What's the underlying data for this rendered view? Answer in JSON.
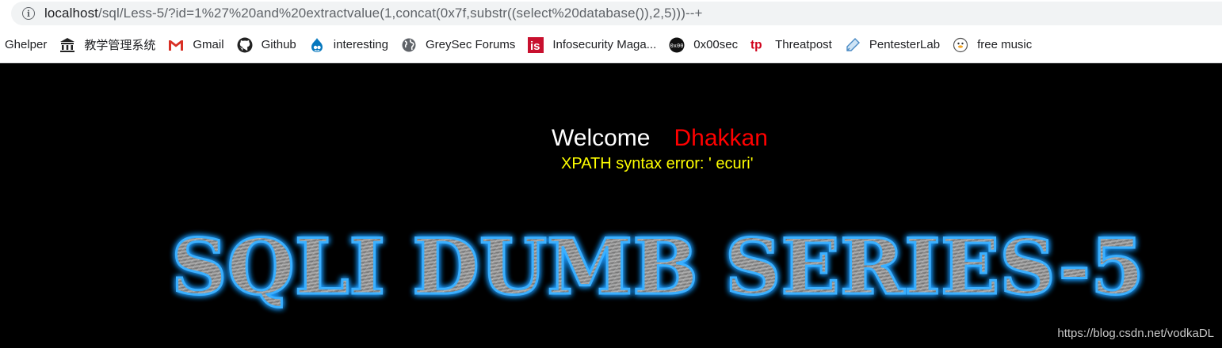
{
  "browser": {
    "url_host": "localhost",
    "url_rest": "/sql/Less-5/?id=1%27%20and%20extractvalue(1,concat(0x7f,substr((select%20database()),2,5)))--+",
    "bookmarks": [
      {
        "label": "Ghelper",
        "icon": "none"
      },
      {
        "label": "教学管理系统",
        "icon": "building-icon"
      },
      {
        "label": "Gmail",
        "icon": "gmail-icon"
      },
      {
        "label": "Github",
        "icon": "github-icon"
      },
      {
        "label": "interesting",
        "icon": "drupal-icon"
      },
      {
        "label": "GreySec Forums",
        "icon": "globe-icon"
      },
      {
        "label": "Infosecurity Maga...",
        "icon": "infosecurity-icon"
      },
      {
        "label": "0x00sec",
        "icon": "0x00sec-icon"
      },
      {
        "label": "Threatpost",
        "icon": "threatpost-icon"
      },
      {
        "label": "PentesterLab",
        "icon": "pentesterlab-icon"
      },
      {
        "label": "free music",
        "icon": "duck-icon"
      }
    ]
  },
  "page": {
    "welcome": "Welcome",
    "username": "Dhakkan",
    "error": "XPATH syntax error: ' ecuri'",
    "title": "SQLI DUMB SERIES-5",
    "watermark": "https://blog.csdn.net/vodkaDL"
  },
  "colors": {
    "background": "#000000",
    "welcome": "#ffffff",
    "username": "#ff0000",
    "error": "#ffff00",
    "title_glow": "#1e9bff",
    "title_fill": "#9a9a9a"
  }
}
